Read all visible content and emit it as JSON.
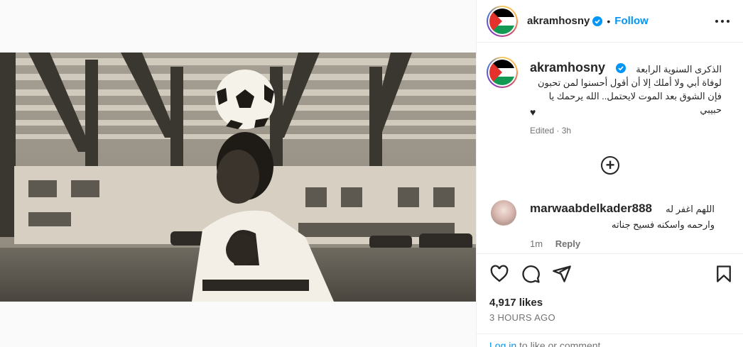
{
  "post": {
    "username": "akramhosny",
    "follow_label": "Follow",
    "separator": "•",
    "caption_lines": "الذكرى السنوية الرابعة\nلوفاة أبي ولا أملك إلا أن أقول أحسنوا لمن تحبون\nفإن الشوق بعد الموت لايحتمل.. الله يرحمك يا حبيبي",
    "caption_heart": "♥",
    "edited": "Edited · 3h",
    "likes": "4,917 likes",
    "time_ago": "3 HOURS AGO"
  },
  "comment": {
    "username": "marwaabdelkader888",
    "text": "اللهم اغفر له\nوارحمه واسكنه فسيح جناته",
    "time": "1m",
    "reply_label": "Reply"
  },
  "footer": {
    "login_label": "Log in",
    "login_rest": " to like or comment."
  },
  "icons": {
    "verified": "verified-badge-icon",
    "more": "more-options-icon",
    "add_comment": "plus-circle-icon",
    "like": "heart-icon",
    "comment": "comment-bubble-icon",
    "share": "paper-plane-icon",
    "save": "bookmark-icon"
  },
  "colors": {
    "accent": "#0095f6",
    "verified": "#0095f6",
    "text": "#262626",
    "muted": "#737373"
  }
}
